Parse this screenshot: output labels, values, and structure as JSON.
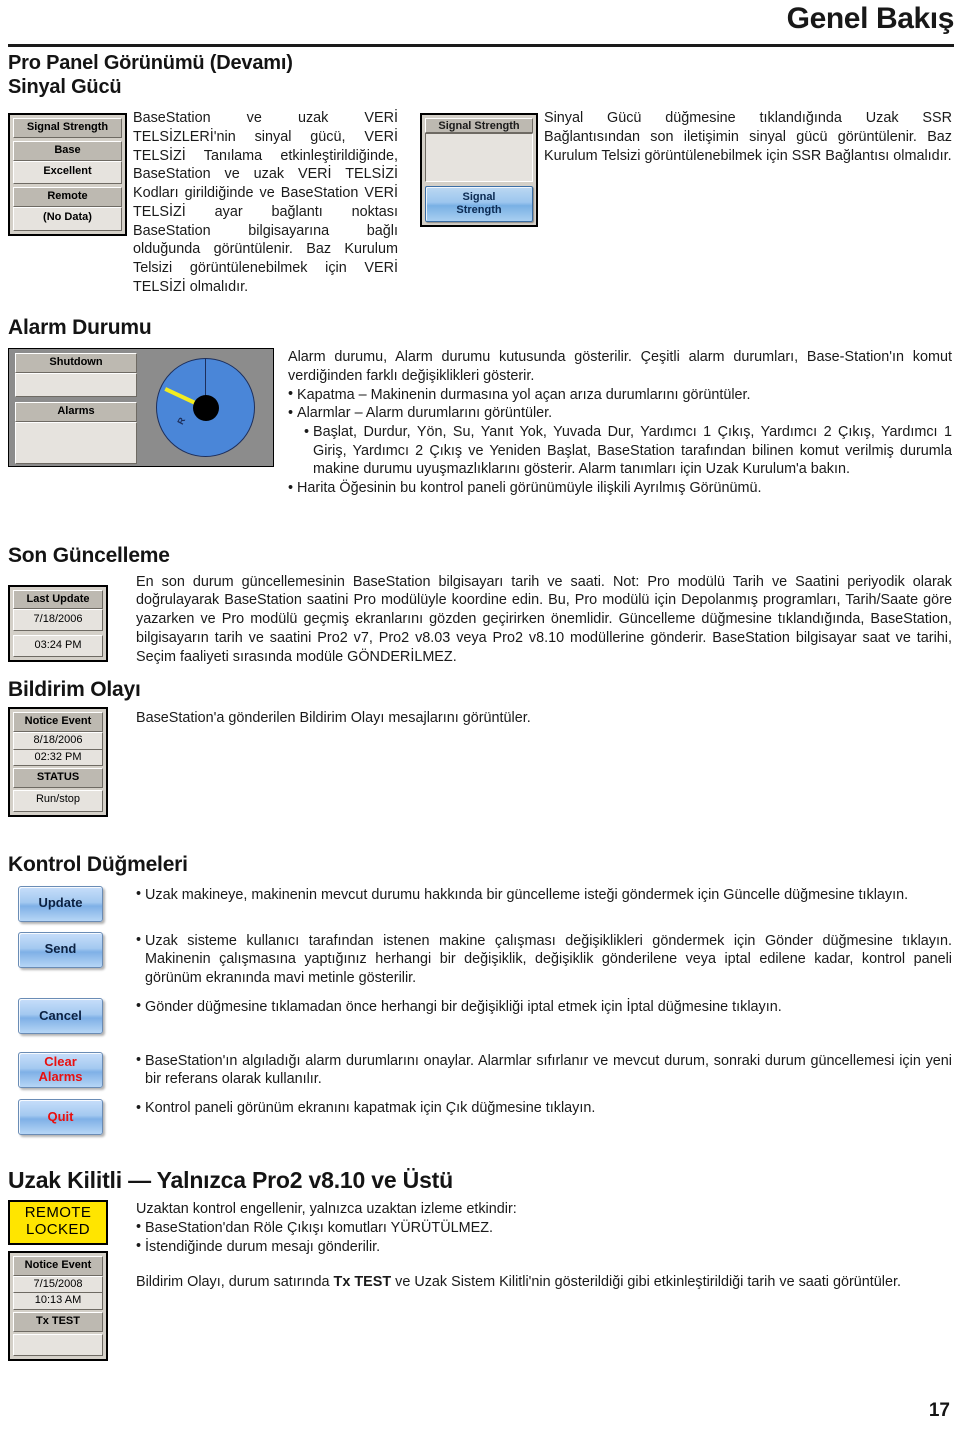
{
  "header": {
    "title": "Genel Bakış"
  },
  "page_number": "17",
  "titles": {
    "pro_panel": "Pro Panel Görünümü (Devamı)",
    "signal_strength": "Sinyal Gücü",
    "alarm_status": "Alarm Durumu",
    "last_update": "Son Güncelleme",
    "notice_event": "Bildirim Olayı",
    "control_buttons": "Kontrol Düğmeleri",
    "remote_locked": "Uzak Kilitli — Yalnızca Pro2 v8.10 ve Üstü"
  },
  "signal_strength": {
    "left_widget": {
      "title": "Signal Strength",
      "base_label": "Base",
      "base_value": "Excellent",
      "remote_label": "Remote",
      "remote_value": "(No Data)"
    },
    "right_widget": {
      "title": "Signal Strength",
      "button_line1": "Signal",
      "button_line2": "Strength"
    },
    "left_text": "BaseStation ve uzak VERİ TELSİZLERİ'nin sinyal gücü, VERİ TELSİZİ Tanılama etkinleştirildiğinde, BaseStation ve uzak VERİ TELSİZİ Kodları girildiğinde ve BaseStation VERİ TELSİZİ ayar bağlantı noktası BaseStation bilgisayarına bağlı olduğunda görüntülenir. Baz Kurulum Telsizi görüntülenebilmek için VERİ TELSİZİ olmalıdır.",
    "right_text": "Sinyal Gücü düğmesine tıklandığında Uzak SSR Bağlantısından son iletişimin sinyal gücü görüntülenir. Baz Kurulum Telsizi görüntülenebilmek için SSR Bağlantısı olmalıdır."
  },
  "alarm_status": {
    "widget": {
      "shutdown_label": "Shutdown",
      "shutdown_value": "",
      "alarms_label": "Alarms",
      "alarms_value": "",
      "gauge_marker": "R"
    },
    "intro": "Alarm durumu, Alarm durumu kutusunda gösterilir. Çeşitli alarm durumları, Base-Station'ın komut verdiğinden farklı değişiklikleri gösterir.",
    "bullets": [
      "Kapatma – Makinenin durmasına yol açan arıza durumlarını görüntüler.",
      "Alarmlar – Alarm durumlarını görüntüler."
    ],
    "sub_bullet": "Başlat, Durdur, Yön, Su, Yanıt Yok, Yuvada Dur, Yardımcı 1 Çıkış, Yardımcı 2 Çıkış, Yardımcı 1 Giriş, Yardımcı 2 Çıkış ve Yeniden Başlat, BaseStation tarafından bilinen komut verilmiş durumla makine durumu uyuşmazlıklarını gösterir. Alarm tanımları için Uzak Kurulum'a bakın.",
    "last_bullet": "Harita Öğesinin bu kontrol paneli görünümüyle ilişkili Ayrılmış Görünümü."
  },
  "last_update": {
    "widget": {
      "title": "Last Update",
      "date": "7/18/2006",
      "time": "03:24 PM"
    },
    "text": "En son durum güncellemesinin BaseStation bilgisayarı tarih ve saati. Not: Pro modülü Tarih ve Saatini periyodik olarak doğrulayarak BaseStation saatini Pro modülüyle koordine edin. Bu, Pro modülü için Depolanmış programları, Tarih/Saate göre yazarken ve Pro modülü geçmiş ekranlarını gözden geçirirken önemlidir. Güncelleme düğmesine tıklandığında, BaseStation, bilgisayarın tarih ve saatini Pro2 v7, Pro2 v8.03 veya Pro2 v8.10 modüllerine gönderir. BaseStation bilgisayar saat ve tarihi, Seçim faaliyeti sırasında modüle GÖNDERİLMEZ."
  },
  "notice_event": {
    "widget": {
      "title": "Notice Event",
      "date": "8/18/2006",
      "time": "02:32 PM",
      "status_label": "STATUS",
      "status_value": "Run/stop"
    },
    "text": "BaseStation'a gönderilen Bildirim Olayı mesajlarını görüntüler."
  },
  "control_buttons": {
    "buttons": [
      {
        "label": "Update",
        "color": "dark"
      },
      {
        "label": "Send",
        "color": "dark"
      },
      {
        "label": "Cancel",
        "color": "dark"
      },
      {
        "label": "Clear\nAlarms",
        "color": "red"
      },
      {
        "label": "Quit",
        "color": "red"
      }
    ],
    "button_labels": {
      "update": "Update",
      "send": "Send",
      "cancel": "Cancel",
      "clear_alarms_line1": "Clear",
      "clear_alarms_line2": "Alarms",
      "quit": "Quit"
    },
    "descriptions": [
      "Uzak makineye, makinenin mevcut durumu hakkında bir güncelleme isteği göndermek için Güncelle düğmesine tıklayın.",
      "Uzak sisteme kullanıcı tarafından istenen makine çalışması değişiklikleri göndermek için Gönder düğmesine tıklayın. Makinenin çalışmasına yaptığınız herhangi bir değişiklik, değişiklik gönderilene veya iptal edilene kadar, kontrol paneli görünüm ekranında mavi metinle gösterilir.",
      "Gönder düğmesine tıklamadan önce herhangi bir değişikliği iptal etmek için İptal düğmesine tıklayın.",
      "BaseStation'ın algıladığı alarm durumlarını onaylar. Alarmlar sıfırlanır ve mevcut durum, sonraki durum güncellemesi için yeni bir referans olarak kullanılır.",
      "Kontrol paneli görünüm ekranını kapatmak için Çık düğmesine tıklayın."
    ]
  },
  "remote_locked": {
    "badge_line1": "REMOTE",
    "badge_line2": "LOCKED",
    "widget": {
      "title": "Notice Event",
      "date": "7/15/2008",
      "time": "10:13 AM",
      "status": "Tx TEST",
      "blank": ""
    },
    "intro": "Uzaktan kontrol engellenir, yalnızca uzaktan izleme etkindir:",
    "bullets": [
      "BaseStation'dan Röle Çıkışı komutları YÜRÜTÜLMEZ.",
      "İstendiğinde durum mesajı gönderilir."
    ],
    "footer_part1": "Bildirim Olayı, durum satırında ",
    "footer_bold": "Tx TEST",
    "footer_part2": " ve Uzak Sistem Kilitli'nin gösterildiği gibi etkinleştirildiği tarih ve saati görüntüler."
  },
  "colors": {
    "badge_yellow": "#ffe500",
    "button_blue": "#9cc6ee",
    "alert_red": "#e8100f",
    "gauge_blue": "#4a86d8",
    "needle_yellow": "#f2ec20"
  }
}
